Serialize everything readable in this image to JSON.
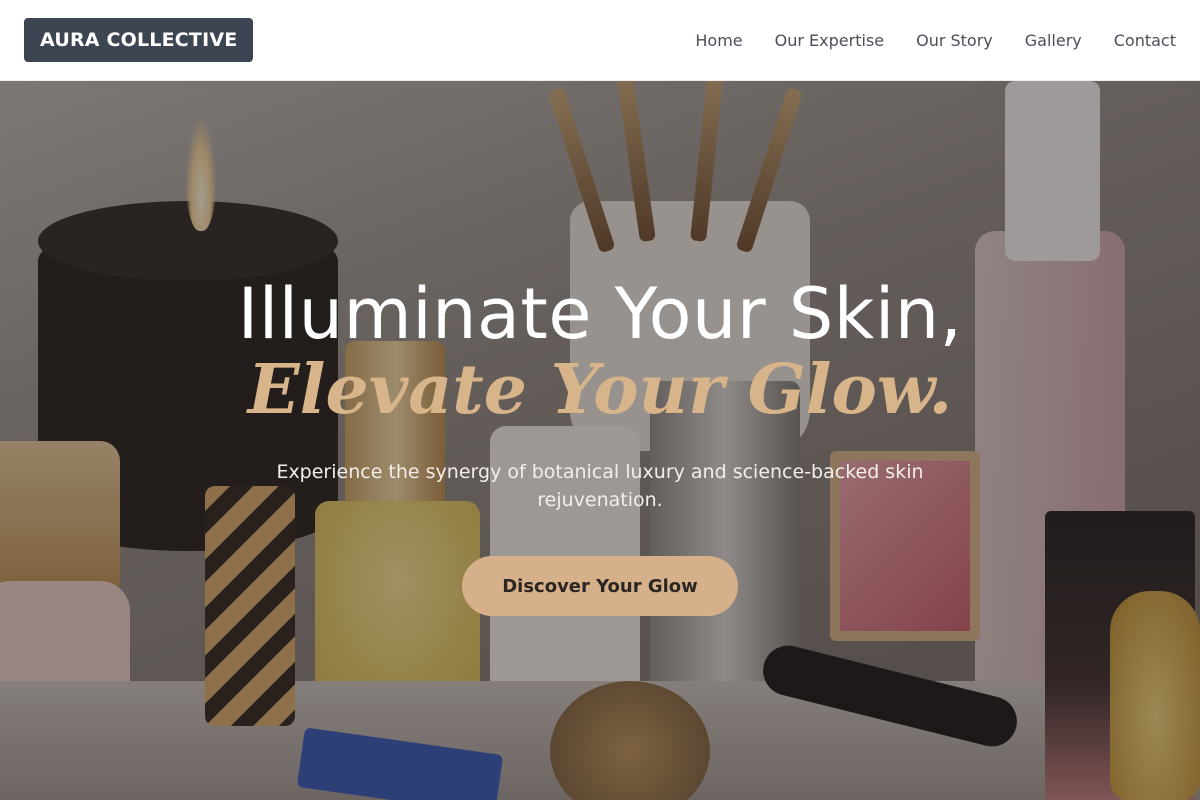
{
  "header": {
    "logo": "AURA COLLECTIVE",
    "nav": [
      {
        "label": "Home"
      },
      {
        "label": "Our Expertise"
      },
      {
        "label": "Our Story"
      },
      {
        "label": "Gallery"
      },
      {
        "label": "Contact"
      }
    ]
  },
  "hero": {
    "headline": "Illuminate Your Skin,",
    "subheadline": "Elevate Your Glow.",
    "tagline": "Experience the synergy of botanical luxury and science-backed skin rejuvenation.",
    "cta_label": "Discover Your Glow"
  },
  "colors": {
    "logo_bg": "#3d4452",
    "accent_gold": "#d6b08a",
    "subheadline": "#d8b48a",
    "nav_text": "#4a4f5a"
  },
  "icons": {
    "background": "cosmetics-vanity-photo"
  }
}
